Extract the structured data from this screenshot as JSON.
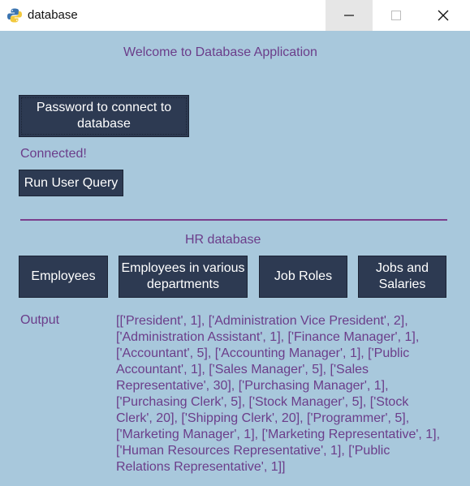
{
  "window": {
    "title": "database"
  },
  "main": {
    "welcome": "Welcome to Database Application",
    "password_button": "Password to connect to database",
    "status": "Connected!",
    "run_query_button": "Run User Query",
    "hr_title": "HR database",
    "buttons": {
      "employees": "Employees",
      "employees_departments": "Employees in various departments",
      "job_roles": "Job Roles",
      "jobs_salaries": "Jobs and Salaries"
    },
    "output_label": "Output",
    "output_text": "[['President', 1], ['Administration Vice President', 2], ['Administration Assistant', 1], ['Finance Manager', 1], ['Accountant', 5], ['Accounting Manager', 1], ['Public Accountant', 1], ['Sales Manager', 5], ['Sales Representative', 30], ['Purchasing Manager', 1], ['Purchasing Clerk', 5], ['Stock Manager', 5], ['Stock Clerk', 20], ['Shipping Clerk', 20], ['Programmer', 5], ['Marketing Manager', 1], ['Marketing Representative', 1], ['Human Resources Representative', 1], ['Public Relations Representative', 1]]"
  },
  "colors": {
    "background": "#a8c8dc",
    "button": "#2d3a52",
    "text_purple": "#6b3d8a"
  },
  "icons": {
    "app": "python-icon",
    "minimize": "minimize-icon",
    "maximize": "maximize-icon",
    "close": "close-icon"
  }
}
